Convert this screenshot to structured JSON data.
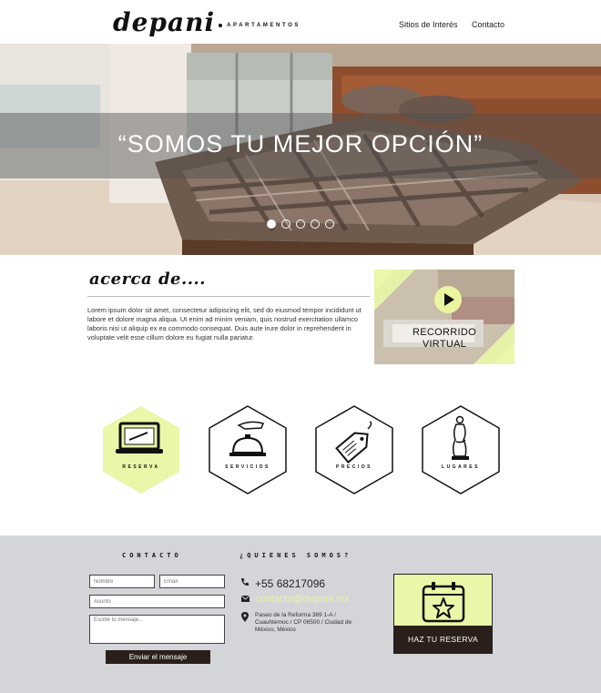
{
  "header": {
    "logo_main": "depani",
    "logo_sub": "APARTAMENTOS",
    "nav": [
      "Sitios de Interés",
      "Contacto"
    ]
  },
  "hero": {
    "title": "“SOMOS TU MEJOR OPCIÓN”",
    "slides_count": 5,
    "active_slide": 1
  },
  "about": {
    "title": "acerca de....",
    "text": "Lorem ipsum dolor sit amet, consectetur adipiscing elit, sed do eiusmod tempor incididunt ut labore et dolore magna aliqua. Ut enim ad minim veniam, quis nostrud exercitation ullamco laboris nisi ut aliquip ex ea commodo consequat. Duis aute irure dolor in reprehenderit in voluptate velit esse cillum dolore eu fugiat nulla pariatur.",
    "tour_label_1": "RECORRIDO",
    "tour_label_2": "VIRTUAL"
  },
  "services": [
    {
      "label": "RESERVA",
      "icon": "laptop-icon",
      "highlight": true
    },
    {
      "label": "SERVICIOS",
      "icon": "service-bell-icon",
      "highlight": false
    },
    {
      "label": "PRECIOS",
      "icon": "price-tag-icon",
      "highlight": false
    },
    {
      "label": "LUGARES",
      "icon": "statue-icon",
      "highlight": false
    }
  ],
  "contact": {
    "title": "CONTACTO",
    "name_placeholder": "Nombre",
    "email_placeholder": "Email",
    "subject_placeholder": "Asunto",
    "message_placeholder": "Escibe tu mensaje...",
    "send_label": "Enviar el mensaje"
  },
  "about_us": {
    "title": "¿QUIENES SOMOS?",
    "phone": "+55 68217096",
    "email": "contacto@depani.mx",
    "address": "Paseo de la Reforma 369 1-A / Cuauhtémoc / CP 06500 / Ciudad de México, México"
  },
  "reserve": {
    "label": "HAZ TU RESERVA"
  },
  "colors": {
    "accent": "#eaf7a8",
    "dark": "#2a1f1a",
    "footer_bg": "#d4d5d9"
  }
}
